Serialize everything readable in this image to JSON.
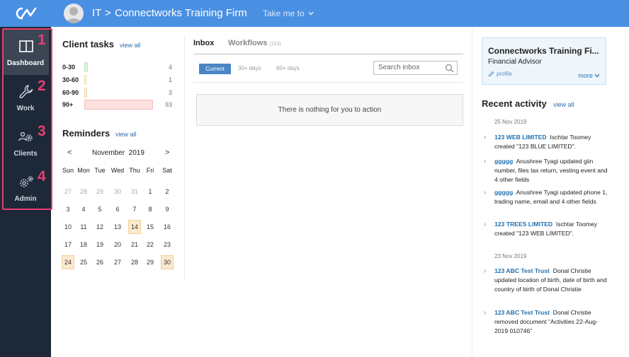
{
  "topbar": {
    "crumb_root": "IT",
    "separator": ">",
    "firm": "Connectworks Training Firm",
    "take_me_to": "Take me to"
  },
  "sidebar": {
    "items": [
      {
        "label": "Dashboard",
        "number": "1",
        "icon": "dashboard-icon"
      },
      {
        "label": "Work",
        "number": "2",
        "icon": "wrench-icon"
      },
      {
        "label": "Clients",
        "number": "3",
        "icon": "clients-gear-icon"
      },
      {
        "label": "Admin",
        "number": "4",
        "icon": "admin-gears-icon"
      }
    ],
    "highlight_color": "#e83e6f"
  },
  "client_tasks": {
    "title": "Client tasks",
    "view_all": "view all",
    "rows": [
      {
        "label": "0-30",
        "count": "4"
      },
      {
        "label": "30-60",
        "count": "1"
      },
      {
        "label": "60-90",
        "count": "3"
      },
      {
        "label": "90+",
        "count": "93"
      }
    ]
  },
  "reminders": {
    "title": "Reminders",
    "view_all": "view all",
    "prev": "<",
    "next": ">",
    "month": "November  2019",
    "dow": [
      "Sun",
      "Mon",
      "Tue",
      "Wed",
      "Thu",
      "Fri",
      "Sat"
    ],
    "weeks": [
      [
        "27",
        "28",
        "29",
        "30",
        "31",
        "1",
        "2"
      ],
      [
        "3",
        "4",
        "5",
        "6",
        "7",
        "8",
        "9"
      ],
      [
        "10",
        "11",
        "12",
        "13",
        "14",
        "15",
        "16"
      ],
      [
        "17",
        "18",
        "19",
        "20",
        "21",
        "22",
        "23"
      ],
      [
        "24",
        "25",
        "26",
        "27",
        "28",
        "29",
        "30"
      ]
    ]
  },
  "inbox": {
    "tab_inbox": "Inbox",
    "tab_workflows": "Workflows",
    "workflows_count": "(123)",
    "filter_current": "Current",
    "filter_30": "30+ days",
    "filter_60": "60+ days",
    "search_placeholder": "Search inbox",
    "empty_message": "There is nothing for you to action"
  },
  "profile": {
    "name": "Connectworks Training Fi...",
    "role": "Financial Advisor",
    "profile_link": "profile",
    "more": "more"
  },
  "activity": {
    "title": "Recent activity",
    "view_all": "view all",
    "groups": [
      {
        "date": "25 Nov 2019",
        "items": [
          {
            "entity": "123 WEB LIMITED",
            "text": "Ischtar Toomey created \"123 BLUE LIMITED\"."
          },
          {
            "entity": "ggggg",
            "text": "Anushree Tyagi updated giin number, files tax return, vesting event and 4 other fields"
          },
          {
            "entity": "ggggg",
            "text": "Anushree Tyagi updated phone 1, trading name, email and 4 other fields"
          },
          {
            "entity": "123 TREES LIMITED",
            "text": "Ischtar Toomey created \"123 WEB LIMITED\"."
          }
        ]
      },
      {
        "date": "23 Nov 2019",
        "items": [
          {
            "entity": "123 ABC Test Trust",
            "text": "Donal Christie updated location of birth, date of birth and country of birth of Donal Christie"
          },
          {
            "entity": "123 ABC Test Trust",
            "text": "Donal Christie removed document \"Activities 22-Aug-2019 010746\""
          }
        ]
      }
    ]
  },
  "colors": {
    "topbar": "#4a90e2",
    "sidebar": "#1d2838",
    "link": "#2f6fb3"
  }
}
